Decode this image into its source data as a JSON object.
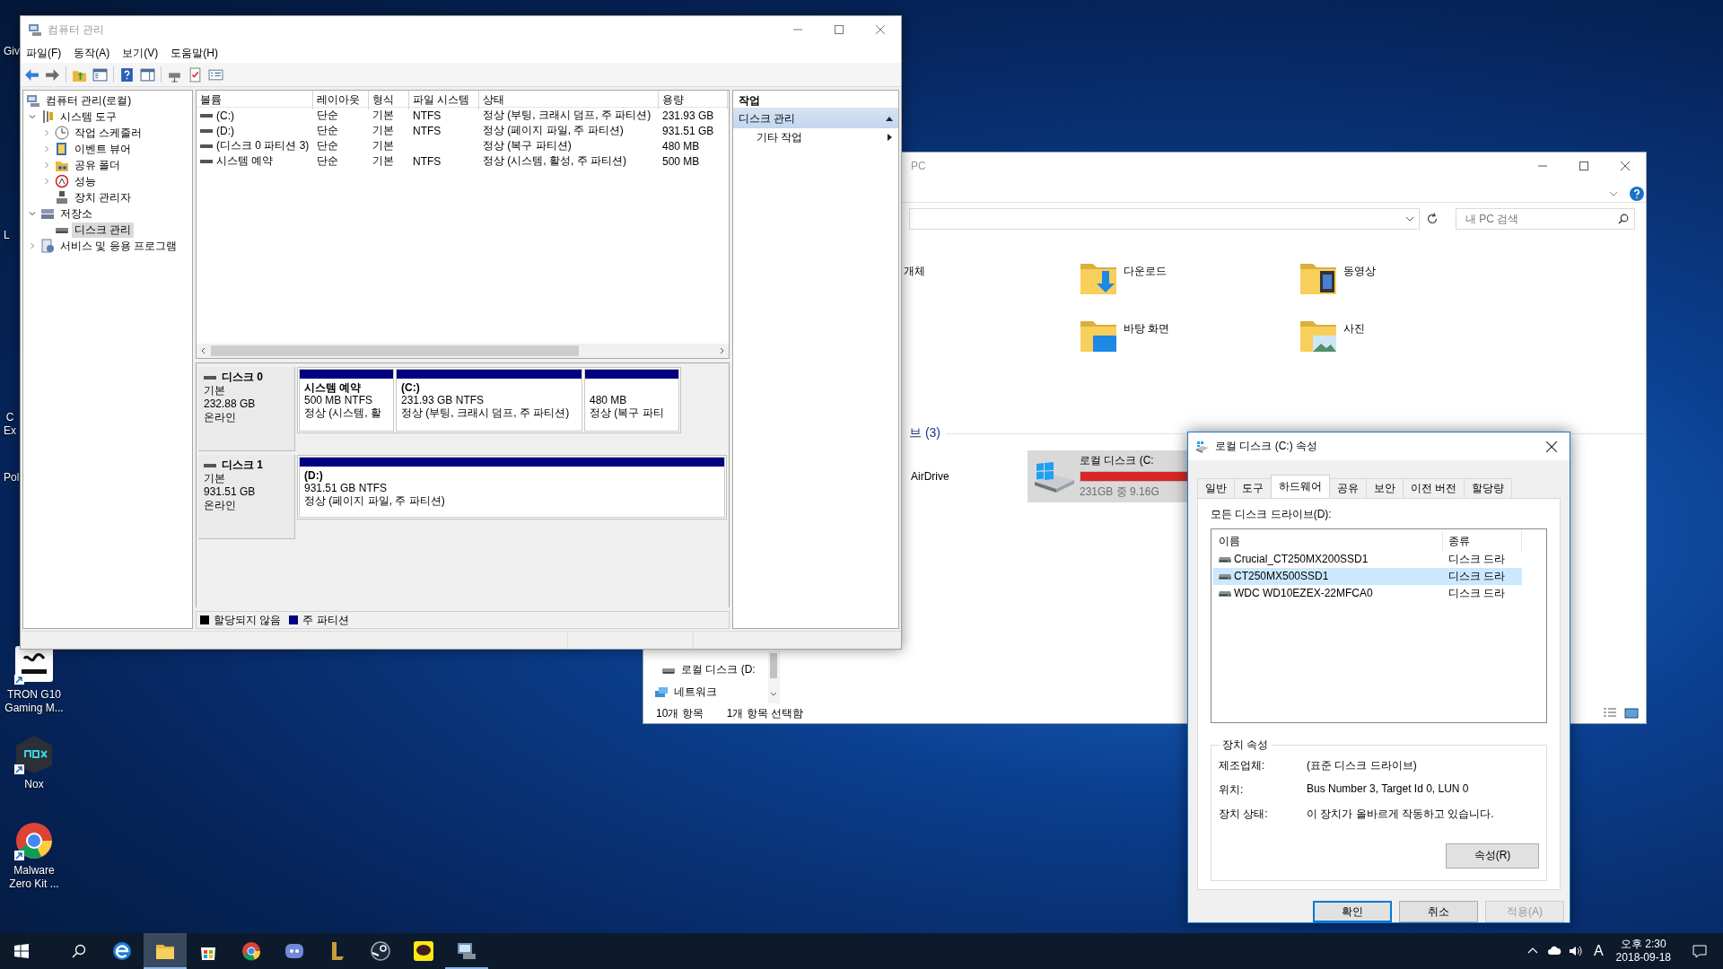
{
  "desktop_icons": [
    {
      "kind": "cut",
      "label": "Giv"
    },
    {
      "kind": "cut",
      "label": "L"
    },
    {
      "kind": "cut",
      "label": "C\nEx"
    },
    {
      "kind": "cut",
      "label": "Pol"
    },
    {
      "kind": "app",
      "label": "TRON G10\nGaming M..."
    },
    {
      "kind": "app",
      "label": "Nox"
    },
    {
      "kind": "app",
      "label": "Malware\nZero Kit ..."
    }
  ],
  "explorer": {
    "title": "PC",
    "search": {
      "placeholder": "내 PC 검색"
    },
    "folders": [
      "개체",
      "다운로드",
      "동영상",
      "바탕 화면",
      "사진"
    ],
    "drives_header": "브 (3)",
    "drives": [
      {
        "kind": "cloud",
        "name": "AirDrive",
        "selected": false
      },
      {
        "kind": "disk",
        "name": "로컬 디스크 (C:",
        "detail": "231GB 중 9.16G",
        "level": 0.96,
        "selected": true
      }
    ],
    "nav": [
      "로컬 디스크 (D:",
      "네트워크"
    ],
    "status": [
      "10개 항목",
      "1개 항목 선택함"
    ]
  },
  "computer_management": {
    "title": "컴퓨터 관리",
    "menu": [
      "파일(F)",
      "동작(A)",
      "보기(V)",
      "도움말(H)"
    ],
    "tree": [
      {
        "label": "컴퓨터 관리(로컬)",
        "selected": false,
        "children": [
          {
            "label": "시스템 도구",
            "expanded": true,
            "selected": false,
            "children": [
              {
                "label": "작업 스케줄러",
                "expanded": false,
                "selected": false
              },
              {
                "label": "이벤트 뷰어",
                "expanded": false,
                "selected": false
              },
              {
                "label": "공유 폴더",
                "expanded": false,
                "selected": false
              },
              {
                "label": "성능",
                "expanded": false,
                "selected": false
              },
              {
                "label": "장치 관리자",
                "selected": false
              }
            ]
          },
          {
            "label": "저장소",
            "expanded": true,
            "selected": false,
            "children": [
              {
                "label": "디스크 관리",
                "selected": true
              }
            ]
          },
          {
            "label": "서비스 및 응용 프로그램",
            "expanded": false,
            "selected": false
          }
        ]
      }
    ],
    "volumes": {
      "columns": [
        "볼륨",
        "레이아웃",
        "형식",
        "파일 시스템",
        "상태",
        "용량"
      ],
      "rows": [
        [
          "(C:)",
          "단순",
          "기본",
          "NTFS",
          "정상 (부팅, 크래시 덤프, 주 파티션)",
          "231.93 GB"
        ],
        [
          "(D:)",
          "단순",
          "기본",
          "NTFS",
          "정상 (페이지 파일, 주 파티션)",
          "931.51 GB"
        ],
        [
          "(디스크 0 파티션 3)",
          "단순",
          "기본",
          "",
          "정상 (복구 파티션)",
          "480 MB"
        ],
        [
          "시스템 예약",
          "단순",
          "기본",
          "NTFS",
          "정상 (시스템, 활성, 주 파티션)",
          "500 MB"
        ]
      ]
    },
    "disks": [
      {
        "name": "디스크 0",
        "type": "기본",
        "size": "232.88 GB",
        "status": "온라인",
        "partitions": [
          {
            "name": "시스템 예약",
            "size": "500 MB NTFS",
            "status": "정상 (시스템, 활",
            "color": "#000080"
          },
          {
            "name": "(C:)",
            "size": "231.93 GB NTFS",
            "status": "정상 (부팅, 크래시 덤프, 주 파티션)",
            "color": "#000080"
          },
          {
            "size": "480 MB",
            "status": "정상 (복구 파티",
            "color": "#000080"
          }
        ]
      },
      {
        "name": "디스크 1",
        "type": "기본",
        "size": "931.51 GB",
        "status": "온라인",
        "partitions": [
          {
            "name": "(D:)",
            "size": "931.51 GB NTFS",
            "status": "정상 (페이지 파일, 주 파티션)",
            "color": "#000080"
          }
        ]
      }
    ],
    "legend": [
      {
        "label": "할당되지 않음",
        "color": "#000000"
      },
      {
        "label": "주 파티션",
        "color": "#000080"
      }
    ],
    "actions": {
      "title": "작업",
      "sections": [
        {
          "label": "디스크 관리",
          "expanded": true,
          "items": [
            "기타 작업"
          ]
        }
      ]
    }
  },
  "properties_dialog": {
    "title": "로컬 디스크 (C:) 속성",
    "tabs": [
      {
        "label": "일반",
        "selected": false
      },
      {
        "label": "도구",
        "selected": false
      },
      {
        "label": "하드웨어",
        "selected": true
      },
      {
        "label": "공유",
        "selected": false
      },
      {
        "label": "보안",
        "selected": false
      },
      {
        "label": "이전 버전",
        "selected": false
      },
      {
        "label": "할당량",
        "selected": false
      }
    ],
    "list_label": "모든 디스크 드라이브(D):",
    "columns": [
      "이름",
      "종류"
    ],
    "drives": [
      {
        "name": "Crucial_CT250MX200SSD1",
        "type": "디스크 드라",
        "selected": false
      },
      {
        "name": "CT250MX500SSD1",
        "type": "디스크 드라",
        "selected": true
      },
      {
        "name": "WDC WD10EZEX-22MFCA0",
        "type": "디스크 드라",
        "selected": false
      }
    ],
    "group_title": "장치 속성",
    "properties": [
      {
        "label": "제조업체:",
        "value": "(표준 디스크 드라이브)"
      },
      {
        "label": "위치:",
        "value": "Bus Number 3, Target Id 0, LUN 0"
      },
      {
        "label": "장치 상태:",
        "value": "이 장치가 올바르게 작동하고 있습니다."
      }
    ],
    "properties_button": "속성(R)",
    "buttons": [
      {
        "label": "확인",
        "default": true,
        "disabled": false
      },
      {
        "label": "취소",
        "default": false,
        "disabled": false
      },
      {
        "label": "적용(A)",
        "default": false,
        "disabled": true
      }
    ]
  },
  "taskbar": {
    "apps": [
      {
        "active": false,
        "running": false
      },
      {
        "active": true,
        "running": true
      },
      {
        "active": false,
        "running": false
      },
      {
        "active": false,
        "running": false
      },
      {
        "active": false,
        "running": false
      },
      {
        "active": false,
        "running": false
      },
      {
        "active": false,
        "running": false
      },
      {
        "active": false,
        "running": false
      },
      {
        "active": false,
        "running": true
      }
    ],
    "ime": "A",
    "time": "오후 2:30",
    "date": "2018-09-18"
  }
}
